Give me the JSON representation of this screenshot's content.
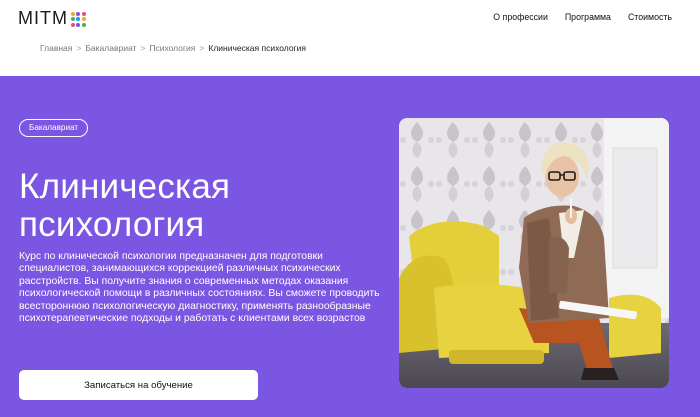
{
  "header": {
    "logo": {
      "text": "MITM",
      "dot_colors": [
        "#f5a623",
        "#7b56e3",
        "#e94b8a",
        "#4caf50",
        "#2196f3",
        "#f5a623",
        "#e94b8a",
        "#7b56e3",
        "#4caf50"
      ]
    },
    "nav": [
      {
        "label": "О профессии"
      },
      {
        "label": "Программа"
      },
      {
        "label": "Стоимость"
      }
    ]
  },
  "breadcrumb": {
    "items": [
      "Главная",
      "Бакалавриат",
      "Психология"
    ],
    "separator": ">",
    "current": "Клиническая психология"
  },
  "hero": {
    "background_color": "#7b56e3",
    "badge": "Бакалавриат",
    "title_line1": "Клиническая",
    "title_line2": "психология",
    "description": "Курс по клинической психологии предназначен для подготовки специалистов, занимающихся коррекцией различных психических расстройств. Вы получите знания о современных методах оказания психологической помощи в различных состояниях. Вы сможете проводить всестороннюю психологическую диагностику, применять разнообразные психотерапевтические подходы и работать с клиентами всех возрастов",
    "cta_label": "Записаться на обучение"
  },
  "photo": {
    "icon": "psychologist-photo"
  }
}
